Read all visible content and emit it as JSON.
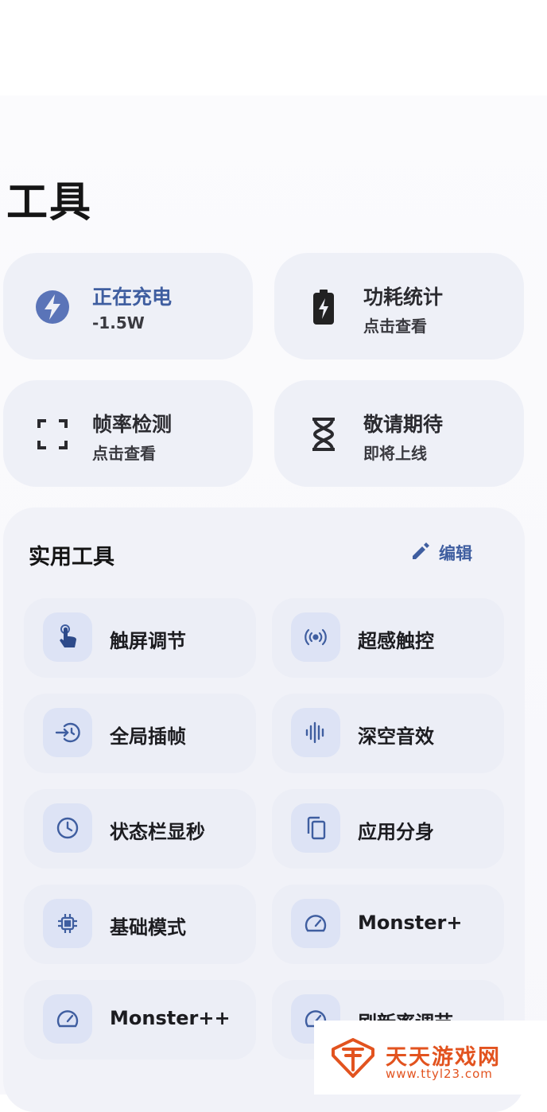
{
  "page": {
    "title": "工具"
  },
  "cards": [
    {
      "id": "charging",
      "title": "正在充电",
      "subtitle": "-1.5W",
      "icon": "bolt-circle-icon"
    },
    {
      "id": "power",
      "title": "功耗统计",
      "subtitle": "点击查看",
      "icon": "battery-charging-icon"
    },
    {
      "id": "fps",
      "title": "帧率检测",
      "subtitle": "点击查看",
      "icon": "frame-corners-icon"
    },
    {
      "id": "soon",
      "title": "敬请期待",
      "subtitle": "即将上线",
      "icon": "hourglass-icon"
    }
  ],
  "tools_panel": {
    "title": "实用工具",
    "edit_label": "编辑",
    "items": [
      {
        "label": "触屏调节",
        "icon": "touch-hand-icon"
      },
      {
        "label": "超感触控",
        "icon": "signal-waves-icon"
      },
      {
        "label": "全局插帧",
        "icon": "frame-insert-icon"
      },
      {
        "label": "深空音效",
        "icon": "audio-bars-icon"
      },
      {
        "label": "状态栏显秒",
        "icon": "clock-icon"
      },
      {
        "label": "应用分身",
        "icon": "copy-icon"
      },
      {
        "label": "基础模式",
        "icon": "chip-icon"
      },
      {
        "label": "Monster+",
        "icon": "speedometer-icon"
      },
      {
        "label": "Monster++",
        "icon": "speedometer-icon"
      },
      {
        "label": "刷新率调节",
        "icon": "speedometer-icon"
      }
    ]
  },
  "watermark": {
    "name": "天天游戏网",
    "url": "www.ttyl23.com"
  },
  "colors": {
    "accent": "#3f5ea0",
    "card_bg": "#eef0f7",
    "icon_bg": "#dde3f5",
    "watermark": "#e2531f"
  }
}
